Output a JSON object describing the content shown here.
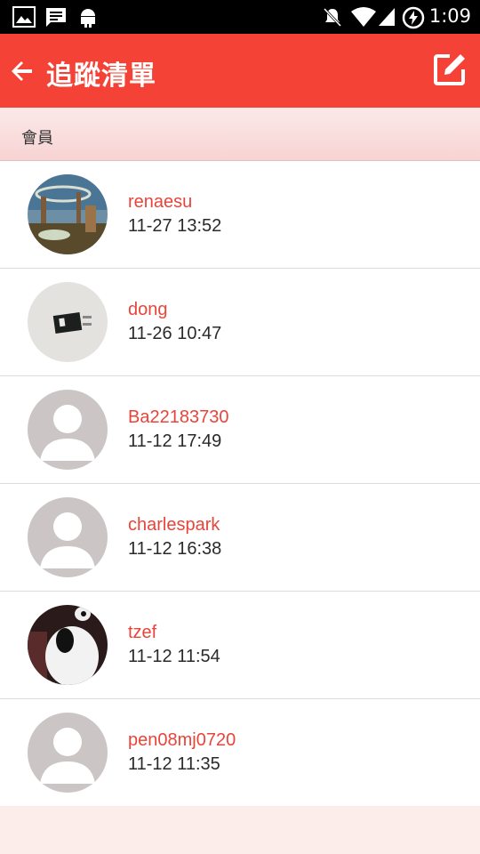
{
  "status_bar": {
    "time": "1:09",
    "icons": [
      "image-notification-icon",
      "message-notification-icon",
      "android-icon",
      "mute-icon",
      "wifi-icon",
      "signal-icon",
      "battery-charging-icon"
    ]
  },
  "app_bar": {
    "title": "追蹤清單",
    "back_icon": "arrow-left-icon",
    "edit_icon": "edit-icon",
    "background": "#f44336"
  },
  "section": {
    "title": "會員"
  },
  "members": [
    {
      "name": "renaesu",
      "time": "11-27 13:52",
      "avatar": "landscape-photo"
    },
    {
      "name": "dong",
      "time": "11-26 10:47",
      "avatar": "object-photo"
    },
    {
      "name": "Ba22183730",
      "time": "11-12 17:49",
      "avatar": "default-person"
    },
    {
      "name": "charlespark",
      "time": "11-12 16:38",
      "avatar": "default-person"
    },
    {
      "name": "tzef",
      "time": "11-12 11:54",
      "avatar": "pet-photo"
    },
    {
      "name": "pen08mj0720",
      "time": "11-12 11:35",
      "avatar": "default-person"
    }
  ],
  "colors": {
    "accent": "#e8453a",
    "background": "#fcecea"
  }
}
